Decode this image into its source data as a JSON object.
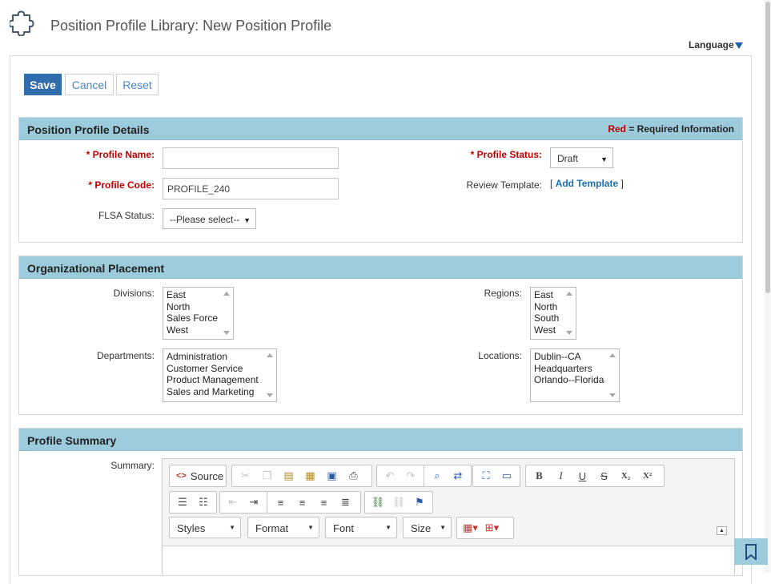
{
  "header": {
    "title": "Position Profile Library: New Position Profile",
    "language_label": "Language"
  },
  "actions": {
    "save": "Save",
    "cancel": "Cancel",
    "reset": "Reset"
  },
  "details": {
    "title": "Position Profile Details",
    "required_red": "Red",
    "required_rest": " = Required Information",
    "profile_name_label": "* Profile Name:",
    "profile_name_value": "",
    "profile_code_label": "* Profile Code:",
    "profile_code_value": "PROFILE_240",
    "flsa_label": "FLSA Status:",
    "flsa_value": "--Please select--",
    "profile_status_label": "* Profile Status:",
    "profile_status_value": "Draft",
    "review_template_label": "Review Template:",
    "add_template_link": "Add Template",
    "bracket_open": "[",
    "bracket_close": "]"
  },
  "placement": {
    "title": "Organizational Placement",
    "divisions_label": "Divisions:",
    "divisions": [
      "East",
      "North",
      "Sales Force",
      "West"
    ],
    "regions_label": "Regions:",
    "regions": [
      "East",
      "North",
      "South",
      "West"
    ],
    "departments_label": "Departments:",
    "departments": [
      "Administration",
      "Customer Service",
      "Product Management",
      "Sales and Marketing"
    ],
    "locations_label": "Locations:",
    "locations": [
      "Dublin--CA",
      "Headquarters",
      "Orlando--Florida"
    ]
  },
  "summary": {
    "title": "Profile Summary",
    "summary_label": "Summary:",
    "source_label": "Source",
    "styles": "Styles",
    "format": "Format",
    "font": "Font",
    "size": "Size",
    "bold": "B",
    "italic": "I",
    "underline": "U",
    "strike": "S",
    "subscript": "X₂",
    "superscript": "X²"
  },
  "colors": {
    "accent": "#2f6dad",
    "panel_header": "#9ccbdc",
    "required": "#c00000",
    "link": "#1a6fb8"
  }
}
